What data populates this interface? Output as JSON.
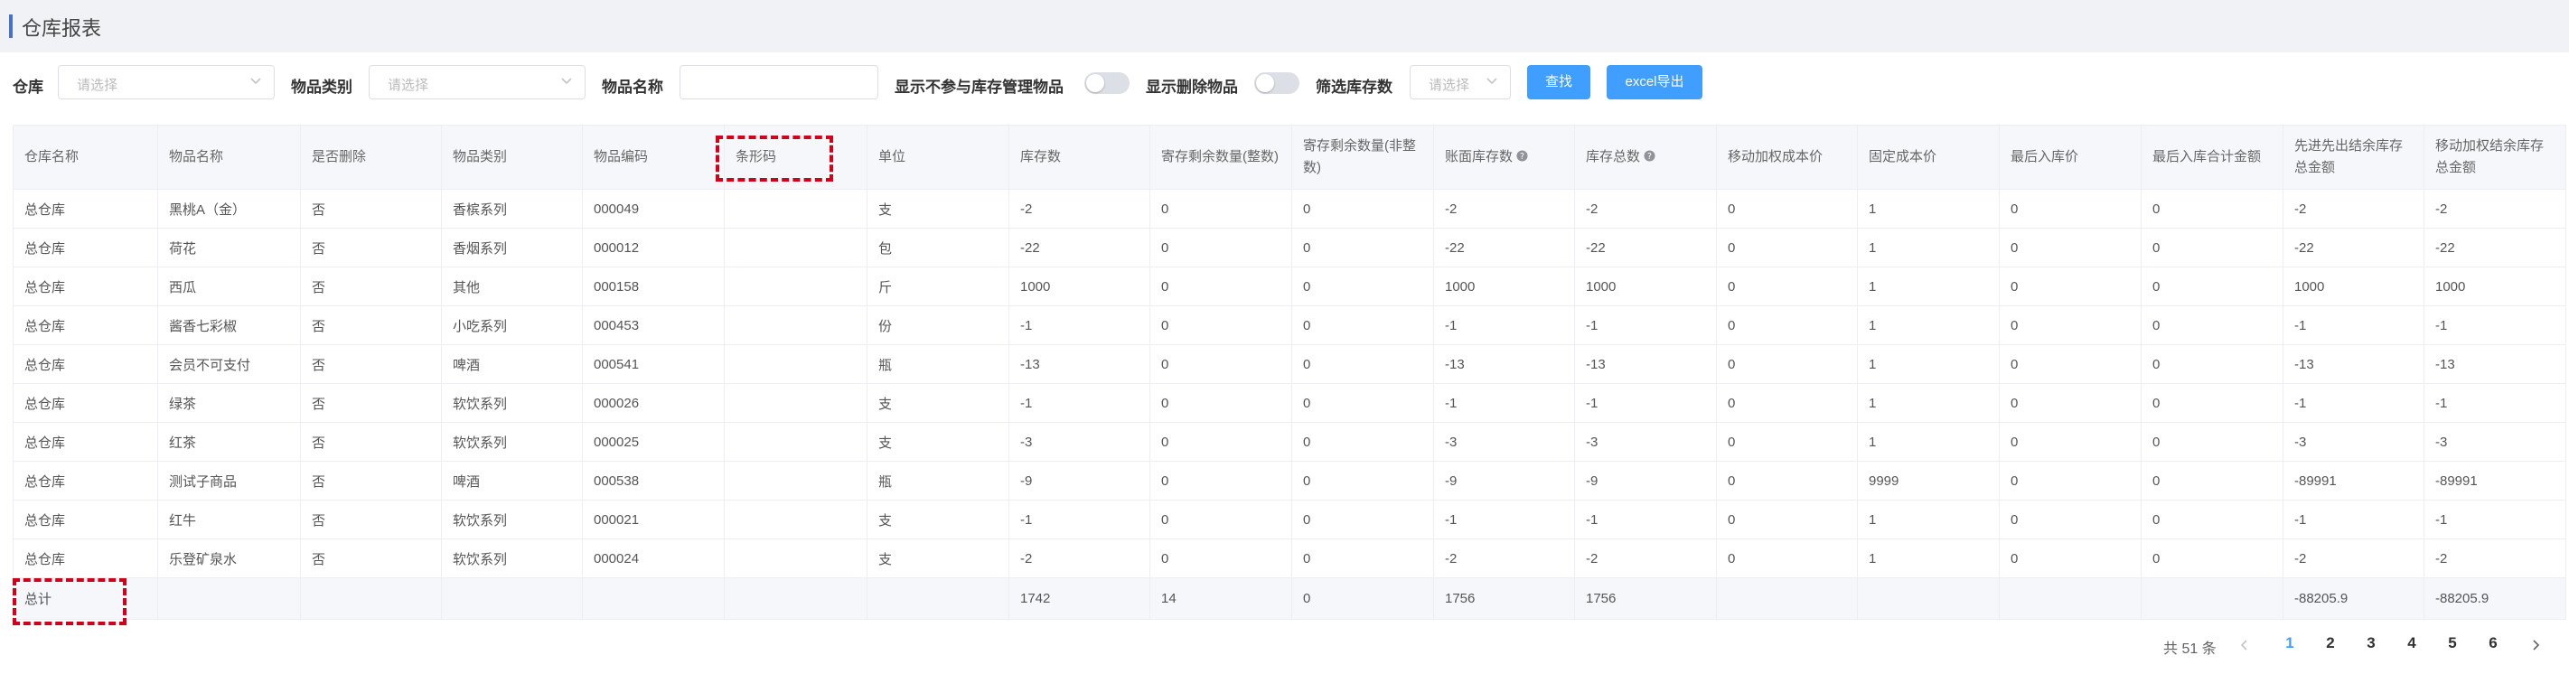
{
  "header": {
    "title": "仓库报表"
  },
  "filters": {
    "warehouse_label": "仓库",
    "warehouse_placeholder": "请选择",
    "category_label": "物品类别",
    "category_placeholder": "请选择",
    "name_label": "物品名称",
    "name_value": "",
    "toggle1_label": "显示不参与库存管理物品",
    "toggle1_on": false,
    "toggle2_label": "显示删除物品",
    "toggle2_on": false,
    "stock_label": "筛选库存数",
    "stock_placeholder": "请选择",
    "search_button": "查找",
    "export_button": "excel导出"
  },
  "table": {
    "headers": [
      "仓库名称",
      "物品名称",
      "是否删除",
      "物品类别",
      "物品编码",
      "条形码",
      "单位",
      "库存数",
      "寄存剩余数量(整数)",
      "寄存剩余数量(非整数)",
      "账面库存数",
      "库存总数",
      "移动加权成本价",
      "固定成本价",
      "最后入库价",
      "最后入库合计金额",
      "先进先出结余库存总金额",
      "移动加权结余库存总金额"
    ],
    "rows": [
      [
        "总仓库",
        "黑桃A（金）",
        "否",
        "香槟系列",
        "000049",
        "",
        "支",
        "-2",
        "0",
        "0",
        "-2",
        "-2",
        "0",
        "1",
        "0",
        "0",
        "-2",
        "-2"
      ],
      [
        "总仓库",
        "荷花",
        "否",
        "香烟系列",
        "000012",
        "",
        "包",
        "-22",
        "0",
        "0",
        "-22",
        "-22",
        "0",
        "1",
        "0",
        "0",
        "-22",
        "-22"
      ],
      [
        "总仓库",
        "西瓜",
        "否",
        "其他",
        "000158",
        "",
        "斤",
        "1000",
        "0",
        "0",
        "1000",
        "1000",
        "0",
        "1",
        "0",
        "0",
        "1000",
        "1000"
      ],
      [
        "总仓库",
        "酱香七彩椒",
        "否",
        "小吃系列",
        "000453",
        "",
        "份",
        "-1",
        "0",
        "0",
        "-1",
        "-1",
        "0",
        "1",
        "0",
        "0",
        "-1",
        "-1"
      ],
      [
        "总仓库",
        "会员不可支付",
        "否",
        "啤酒",
        "000541",
        "",
        "瓶",
        "-13",
        "0",
        "0",
        "-13",
        "-13",
        "0",
        "1",
        "0",
        "0",
        "-13",
        "-13"
      ],
      [
        "总仓库",
        "绿茶",
        "否",
        "软饮系列",
        "000026",
        "",
        "支",
        "-1",
        "0",
        "0",
        "-1",
        "-1",
        "0",
        "1",
        "0",
        "0",
        "-1",
        "-1"
      ],
      [
        "总仓库",
        "红茶",
        "否",
        "软饮系列",
        "000025",
        "",
        "支",
        "-3",
        "0",
        "0",
        "-3",
        "-3",
        "0",
        "1",
        "0",
        "0",
        "-3",
        "-3"
      ],
      [
        "总仓库",
        "测试子商品",
        "否",
        "啤酒",
        "000538",
        "",
        "瓶",
        "-9",
        "0",
        "0",
        "-9",
        "-9",
        "0",
        "9999",
        "0",
        "0",
        "-89991",
        "-89991"
      ],
      [
        "总仓库",
        "红牛",
        "否",
        "软饮系列",
        "000021",
        "",
        "支",
        "-1",
        "0",
        "0",
        "-1",
        "-1",
        "0",
        "1",
        "0",
        "0",
        "-1",
        "-1"
      ],
      [
        "总仓库",
        "乐登矿泉水",
        "否",
        "软饮系列",
        "000024",
        "",
        "支",
        "-2",
        "0",
        "0",
        "-2",
        "-2",
        "0",
        "1",
        "0",
        "0",
        "-2",
        "-2"
      ]
    ],
    "summary": [
      "总计",
      "",
      "",
      "",
      "",
      "",
      "",
      "1742",
      "14",
      "0",
      "1756",
      "1756",
      "",
      "",
      "",
      "",
      "-88205.9",
      "-88205.9"
    ]
  },
  "pagination": {
    "total_text": "共 51 条",
    "pages": [
      "1",
      "2",
      "3",
      "4",
      "5",
      "6"
    ],
    "current": "1"
  },
  "colors": {
    "primary": "#409eff",
    "highlight": "#d0021b",
    "title_bar": "#4a72c4"
  }
}
